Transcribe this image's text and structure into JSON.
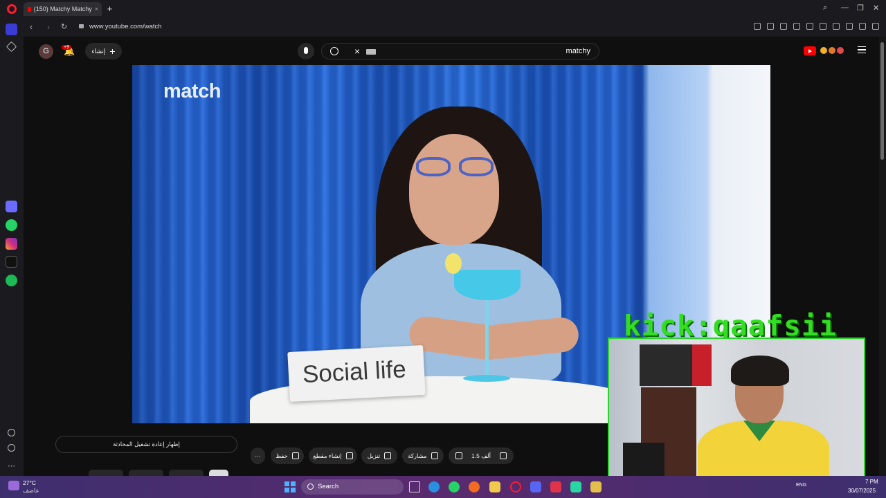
{
  "browser": {
    "tab_title": "(150) Matchy Matchy",
    "tab_close": "×",
    "new_tab": "+",
    "url": "www.youtube.com/watch",
    "window_controls": [
      "—",
      "❐",
      "✕"
    ],
    "search_glyph": "⌕"
  },
  "youtube": {
    "avatar_letter": "G",
    "notifications_badge": "+9",
    "create_label": "إنشاء",
    "create_glyph": "+",
    "search_query": "matchy",
    "clear_glyph": "×"
  },
  "video": {
    "brand": "match",
    "nameplate": "Social life"
  },
  "stream_overlay": {
    "handle": "kick:gaafsii"
  },
  "below_video": {
    "chat_replay_label": "إظهار إعادة تشغيل المحادثة",
    "more_glyph": "⋯",
    "save_label": "حفظ",
    "clip_label": "إنشاء مقطع",
    "download_label": "تنزيل",
    "share_label": "مشاركة",
    "like_count": "1.5 ألف"
  },
  "taskbar": {
    "temperature": "27°C",
    "condition": "عاصف",
    "search_placeholder": "Search",
    "lang": "ENG",
    "time": "7 PM",
    "date": "30/07/2025"
  },
  "colors": {
    "accent_green": "#33dd22",
    "youtube_red": "#ff0000",
    "opera_red": "#ff1b2d"
  }
}
